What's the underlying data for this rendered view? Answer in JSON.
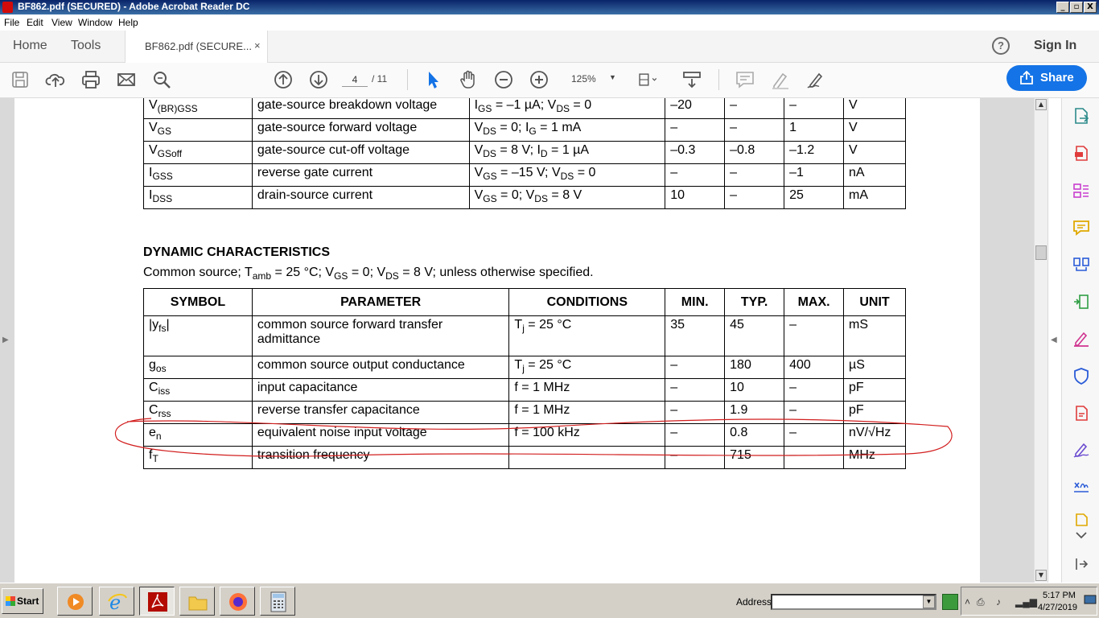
{
  "window": {
    "title": "BF862.pdf (SECURED) - Adobe Acrobat Reader DC",
    "minimize_label": "_",
    "maximize_label": "▫",
    "close_label": "X"
  },
  "menu": {
    "items": [
      "File",
      "Edit",
      "View",
      "Window",
      "Help"
    ]
  },
  "tabs": {
    "home": "Home",
    "tools": "Tools",
    "document": "BF862.pdf (SECURE...",
    "close_glyph": "×",
    "help_glyph": "?",
    "sign_in": "Sign In"
  },
  "toolbar": {
    "page_current": "4",
    "page_total": "/ 11",
    "zoom": "125%",
    "zoom_arrow": "▼",
    "share_label": "Share",
    "accent_color": "#1473e6"
  },
  "static_table": {
    "rows": [
      {
        "symbol": "V",
        "symbol_sub": "(BR)GSS",
        "parameter": "gate-source breakdown voltage",
        "conditions_html": "I<sub>GS</sub> = –1 µA; V<sub>DS</sub> = 0",
        "min": "–20",
        "typ": "–",
        "max": "–",
        "unit": "V"
      },
      {
        "symbol": "V",
        "symbol_sub": "GS",
        "parameter": "gate-source forward voltage",
        "conditions_html": "V<sub>DS</sub> = 0; I<sub>G</sub> = 1 mA",
        "min": "–",
        "typ": "–",
        "max": "1",
        "unit": "V"
      },
      {
        "symbol": "V",
        "symbol_sub": "GSoff",
        "parameter": "gate-source cut-off voltage",
        "conditions_html": "V<sub>DS</sub> = 8 V; I<sub>D</sub> = 1 µA",
        "min": "–0.3",
        "typ": "–0.8",
        "max": "–1.2",
        "unit": "V"
      },
      {
        "symbol": "I",
        "symbol_sub": "GSS",
        "parameter": "reverse gate current",
        "conditions_html": "V<sub>GS</sub> = –15 V; V<sub>DS</sub> = 0",
        "min": "–",
        "typ": "–",
        "max": "–1",
        "unit": "nA"
      },
      {
        "symbol": "I",
        "symbol_sub": "DSS",
        "parameter": "drain-source current",
        "conditions_html": "V<sub>GS</sub> = 0; V<sub>DS</sub> = 8 V",
        "min": "10",
        "typ": "–",
        "max": "25",
        "unit": "mA"
      }
    ]
  },
  "dynamic": {
    "title": "DYNAMIC CHARACTERISTICS",
    "subtitle_html": "Common source; T<sub>amb</sub> = 25 °C; V<sub>GS</sub> = 0; V<sub>DS</sub> = 8 V; unless otherwise specified.",
    "headers": {
      "symbol": "SYMBOL",
      "parameter": "PARAMETER",
      "conditions": "CONDITIONS",
      "min": "MIN.",
      "typ": "TYP.",
      "max": "MAX.",
      "unit": "UNIT"
    },
    "rows": [
      {
        "symbol": "|y",
        "symbol_sub": "fs",
        "symbol_suffix": "|",
        "parameter": "common source forward transfer admittance",
        "conditions_html": "T<sub>j</sub> = 25 °C",
        "min": "35",
        "typ": "45",
        "max": "–",
        "unit": "mS"
      },
      {
        "symbol": "g",
        "symbol_sub": "os",
        "symbol_suffix": "",
        "parameter": "common source output conductance",
        "conditions_html": "T<sub>j</sub> = 25 °C",
        "min": "–",
        "typ": "180",
        "max": "400",
        "unit": "µS"
      },
      {
        "symbol": "C",
        "symbol_sub": "iss",
        "symbol_suffix": "",
        "parameter": "input capacitance",
        "conditions_html": "f = 1 MHz",
        "min": "–",
        "typ": "10",
        "max": "–",
        "unit": "pF"
      },
      {
        "symbol": "C",
        "symbol_sub": "rss",
        "symbol_suffix": "",
        "parameter": "reverse transfer capacitance",
        "conditions_html": "f = 1 MHz",
        "min": "–",
        "typ": "1.9",
        "max": "–",
        "unit": "pF"
      },
      {
        "symbol": "e",
        "symbol_sub": "n",
        "symbol_suffix": "",
        "parameter": "equivalent noise input voltage",
        "conditions_html": "f = 100 kHz",
        "min": "–",
        "typ": "0.8",
        "max": "–",
        "unit": "nV/√Hz"
      },
      {
        "symbol": "f",
        "symbol_sub": "T",
        "symbol_suffix": "",
        "parameter": "transition frequency",
        "conditions_html": "",
        "min": "–",
        "typ": "715",
        "max": "–",
        "unit": "MHz"
      }
    ],
    "annotation_color": "#d21e1e"
  },
  "taskbar": {
    "start_label": "Start",
    "address_label": "Address",
    "time": "5:17 PM",
    "date": "4/27/2019"
  }
}
